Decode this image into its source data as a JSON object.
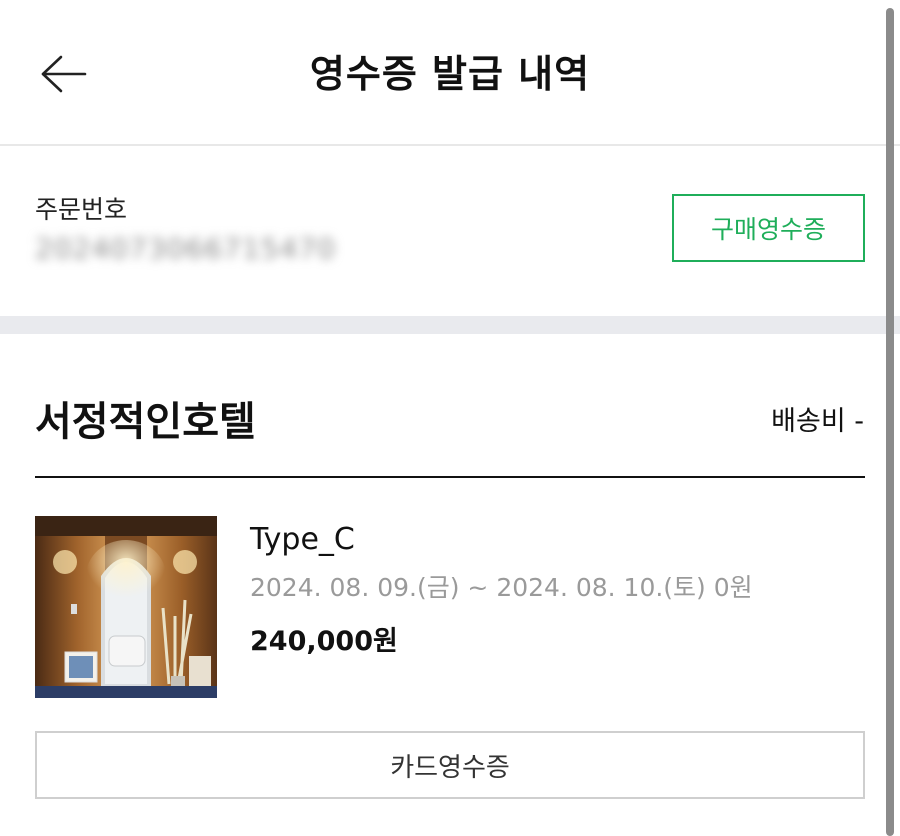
{
  "header": {
    "title": "영수증 발급 내역",
    "back_icon": "arrow-left-icon"
  },
  "order": {
    "label": "주문번호",
    "number": "2024073066715470",
    "purchase_receipt_label": "구매영수증",
    "accent_color": "#1fae5a"
  },
  "store": {
    "name": "서정적인호텔",
    "shipping_label": "배송비 -"
  },
  "item": {
    "name": "Type_C",
    "dates": "2024. 08. 09.(금) ~ 2024. 08. 10.(토) 0원",
    "price": "240,000원",
    "card_receipt_label": "카드영수증"
  }
}
